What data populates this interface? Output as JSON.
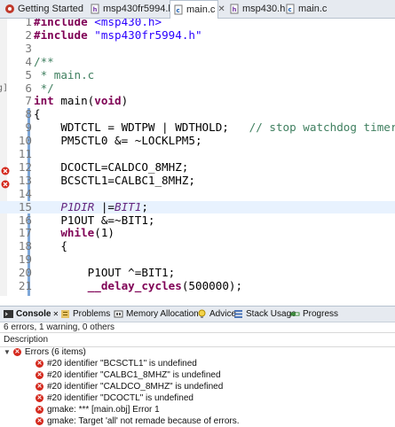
{
  "tabs": [
    {
      "label": "Getting Started",
      "icon": "ccs-icon"
    },
    {
      "label": "msp430fr5994.h",
      "icon": "header-file-icon"
    },
    {
      "label": "main.c",
      "icon": "c-file-icon",
      "active": true
    },
    {
      "label": "msp430.h",
      "icon": "header-file-icon"
    },
    {
      "label": "main.c",
      "icon": "c-file-icon"
    }
  ],
  "editor": {
    "left_stub": "g]",
    "lines": [
      {
        "num": "1",
        "text": "#include <msp430.h>"
      },
      {
        "num": "2",
        "text": "#include \"msp430fr5994.h\""
      },
      {
        "num": "3",
        "text": ""
      },
      {
        "num": "4",
        "text": "/**"
      },
      {
        "num": "5",
        "text": " * main.c"
      },
      {
        "num": "6",
        "text": " */"
      },
      {
        "num": "7",
        "text": "int main(void)"
      },
      {
        "num": "8",
        "text": "{"
      },
      {
        "num": "9",
        "text": "    WDTCTL = WDTPW | WDTHOLD;   // stop watchdog timer"
      },
      {
        "num": "10",
        "text": "    PM5CTL0 &= ~LOCKLPM5;"
      },
      {
        "num": "11",
        "text": ""
      },
      {
        "num": "12",
        "text": "    DCOCTL=CALDCO_8MHZ;"
      },
      {
        "num": "13",
        "text": "    BCSCTL1=CALBC1_8MHZ;"
      },
      {
        "num": "14",
        "text": ""
      },
      {
        "num": "15",
        "text": "    P1DIR |=BIT1;"
      },
      {
        "num": "16",
        "text": "    P1OUT &=~BIT1;"
      },
      {
        "num": "17",
        "text": "    while(1)"
      },
      {
        "num": "18",
        "text": "    {"
      },
      {
        "num": "19",
        "text": ""
      },
      {
        "num": "20",
        "text": "        P1OUT ^=BIT1;"
      },
      {
        "num": "21",
        "text": "        __delay_cycles(500000);"
      }
    ]
  },
  "panel": {
    "tabs": [
      {
        "label": "Console",
        "icon": "console-icon",
        "active": true
      },
      {
        "label": "Problems",
        "icon": "problems-icon"
      },
      {
        "label": "Memory Allocation",
        "icon": "memory-icon"
      },
      {
        "label": "Advice",
        "icon": "lightbulb-icon"
      },
      {
        "label": "Stack Usage",
        "icon": "stack-icon"
      },
      {
        "label": "Progress",
        "icon": "progress-icon"
      }
    ],
    "summary": "6 errors, 1 warning, 0 others",
    "column_header": "Description",
    "group_label": "Errors (6 items)",
    "errors": [
      "#20 identifier \"BCSCTL1\" is undefined",
      "#20 identifier \"CALBC1_8MHZ\" is undefined",
      "#20 identifier \"CALDCO_8MHZ\" is undefined",
      "#20 identifier \"DCOCTL\" is undefined",
      "gmake: *** [main.obj] Error 1",
      "gmake: Target 'all' not remade because of errors."
    ]
  },
  "colors": {
    "keyword": "#7f0055",
    "string": "#2a00ff",
    "comment": "#3f7f5f",
    "macro": "#642880",
    "error": "#d4281c",
    "current_line": "#e8f2fe"
  }
}
